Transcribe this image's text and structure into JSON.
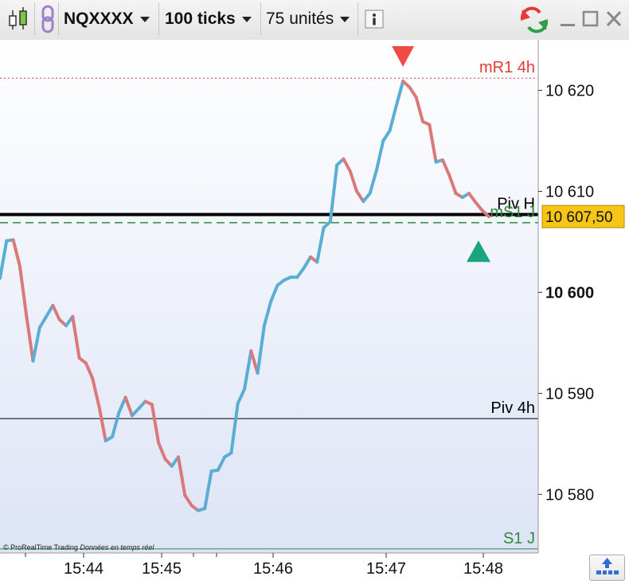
{
  "toolbar": {
    "symbol": "NQXXXX",
    "interval": "100 ticks",
    "units": "75 unités",
    "info_icon": "info-icon",
    "chart_type_icon": "candlestick-icon",
    "link_icon": "chain-link-icon",
    "refresh_icon": "refresh-arrows-icon",
    "minimize_icon": "minimize-icon",
    "maximize_icon": "maximize-icon",
    "close_icon": "close-icon"
  },
  "credit": {
    "source": "© ProRealTime Trading",
    "status": "Données en temps réel"
  },
  "colors": {
    "up": "#5aaed3",
    "down": "#d9797a",
    "resistance": "#e53935",
    "support": "#2e8b3a",
    "pivot": "#000000",
    "price_tag": "#f5c518",
    "sell_marker": "#ef4b45",
    "buy_marker": "#1aa57f"
  },
  "chart_data": {
    "type": "line",
    "title": "",
    "xlabel": "",
    "ylabel": "",
    "ylim": [
      10574.2,
      10625.0
    ],
    "x_tick_labels": [
      "15:44",
      "15:45",
      "15:46",
      "15:47",
      "15:48"
    ],
    "y_ticks": [
      10580,
      10590,
      10600,
      10610,
      10620
    ],
    "y_tick_labels": [
      "10 580",
      "10 590",
      "10 600",
      "10 610",
      "10 620"
    ],
    "y_major_tick": 10600,
    "last_price": 10607.5,
    "last_price_label": "10 607,50",
    "series": [
      {
        "values": [
          10601.4,
          10605.1,
          10605.2,
          10602.6,
          10597.7,
          10593.2,
          10596.5,
          10597.6,
          10598.7,
          10597.3,
          10596.7,
          10597.6,
          10593.5,
          10593.0,
          10591.5,
          10588.7,
          10585.3,
          10585.7,
          10588.1,
          10589.6,
          10587.8,
          10588.5,
          10589.2,
          10588.9,
          10585.1,
          10583.5,
          10582.8,
          10583.7,
          10579.9,
          10578.9,
          10578.4,
          10578.6,
          10582.3,
          10582.4,
          10583.7,
          10584.1,
          10589.0,
          10590.4,
          10594.2,
          10592.0,
          10596.7,
          10599.1,
          10600.7,
          10601.2,
          10601.5,
          10601.5,
          10602.4,
          10603.5,
          10603.0,
          10606.4,
          10607.0,
          10612.6,
          10613.2,
          10612.0,
          10610.0,
          10609.0,
          10609.8,
          10612.1,
          10615.0,
          10616.0,
          10618.5,
          10620.9,
          10620.3,
          10619.3,
          10616.9,
          10616.6,
          10612.9,
          10613.1,
          10611.6,
          10609.8,
          10609.4,
          10609.8,
          10608.9,
          10608.1,
          10607.5
        ]
      }
    ],
    "levels": [
      {
        "label": "mR1 4h",
        "value": 10621.2,
        "style": "dotted"
      },
      {
        "label": "Piv H",
        "value": 10607.7,
        "style": "solid-thick"
      },
      {
        "label": "mS1 J",
        "value": 10606.9,
        "style": "dashed"
      },
      {
        "label": "Piv 4h",
        "value": 10587.5,
        "style": "solid"
      },
      {
        "label": "S1 J",
        "value": 10574.6,
        "style": "solid"
      }
    ],
    "signals": [
      {
        "type": "sell",
        "value": 10621.2
      },
      {
        "type": "buy",
        "value": 10607.1
      }
    ]
  }
}
